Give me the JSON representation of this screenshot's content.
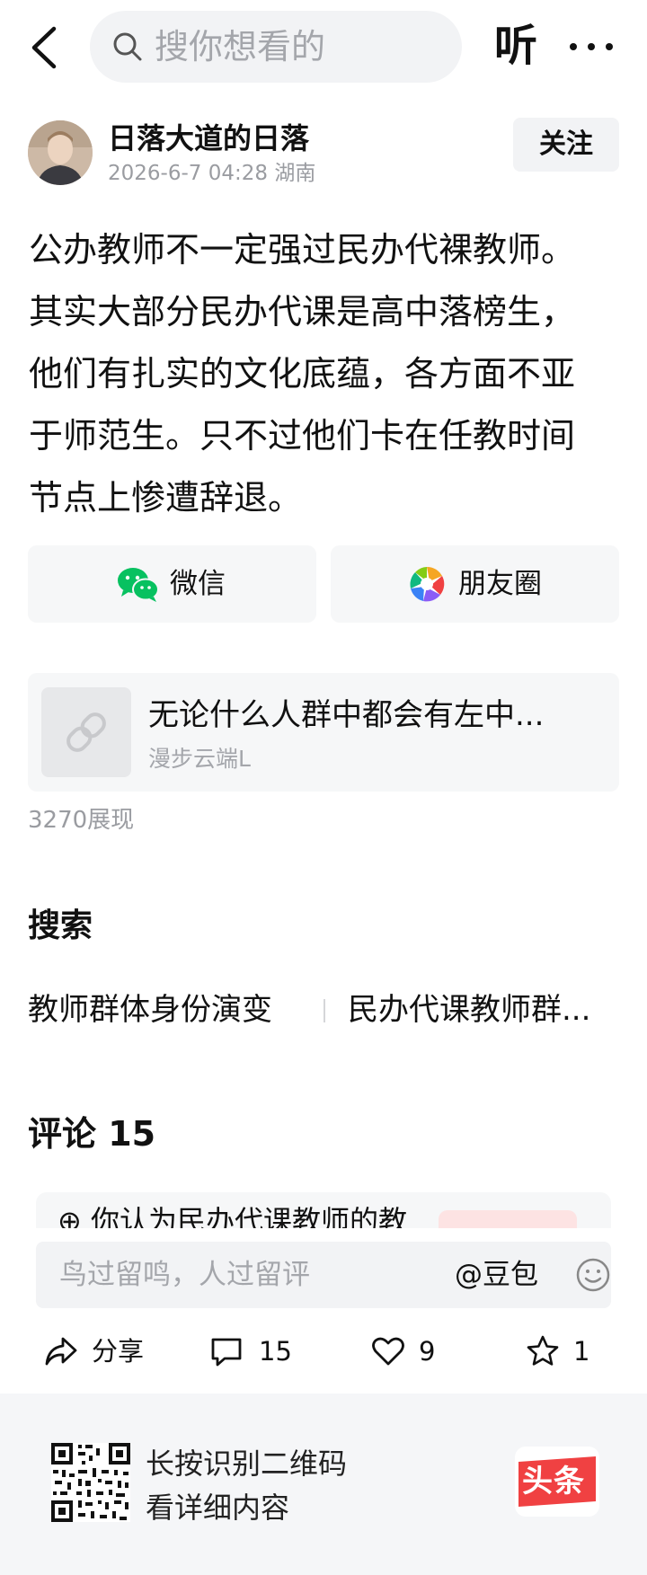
{
  "header": {
    "search_placeholder": "搜你想看的",
    "listen_label": "听",
    "icons": [
      "back-icon",
      "search-icon",
      "more-icon"
    ]
  },
  "author": {
    "name": "日落大道的日落",
    "date": "2026-6-7 04:28",
    "location": "湖南",
    "follow_label": "关注"
  },
  "post": {
    "lines": [
      "公办教师不一定强过民办代裸教师。",
      "其实大部分民办代课是高中落榜生，",
      "他们有扎实的文化底蕴，各方面不亚",
      "于师范生。只不过他们卡在任教时间",
      "节点上惨遭辞退。"
    ]
  },
  "share": {
    "wechat_label": "微信",
    "moments_label": "朋友圈",
    "wechat_color": "#07c160"
  },
  "linked_article": {
    "title": "无论什么人群中都会有左中...",
    "author": "漫步云端L",
    "icon": "link-icon"
  },
  "views_text": "3270展现",
  "search_section": {
    "heading": "搜索",
    "related": [
      "教师群体身份演变",
      "民办代课教师群..."
    ]
  },
  "comments": {
    "heading": "评论 15",
    "peek_text": "你认为民办代课教师的教",
    "input_placeholder": "鸟过留鸣，人过留评",
    "doubao_label": "@豆包"
  },
  "actions": {
    "share_label": "分享",
    "comment_count": "15",
    "like_count": "9",
    "favorite_count": "1"
  },
  "footer": {
    "line1": "长按识别二维码",
    "line2": "看详细内容",
    "logo_text": "头条",
    "logo_color": "#f04142"
  }
}
